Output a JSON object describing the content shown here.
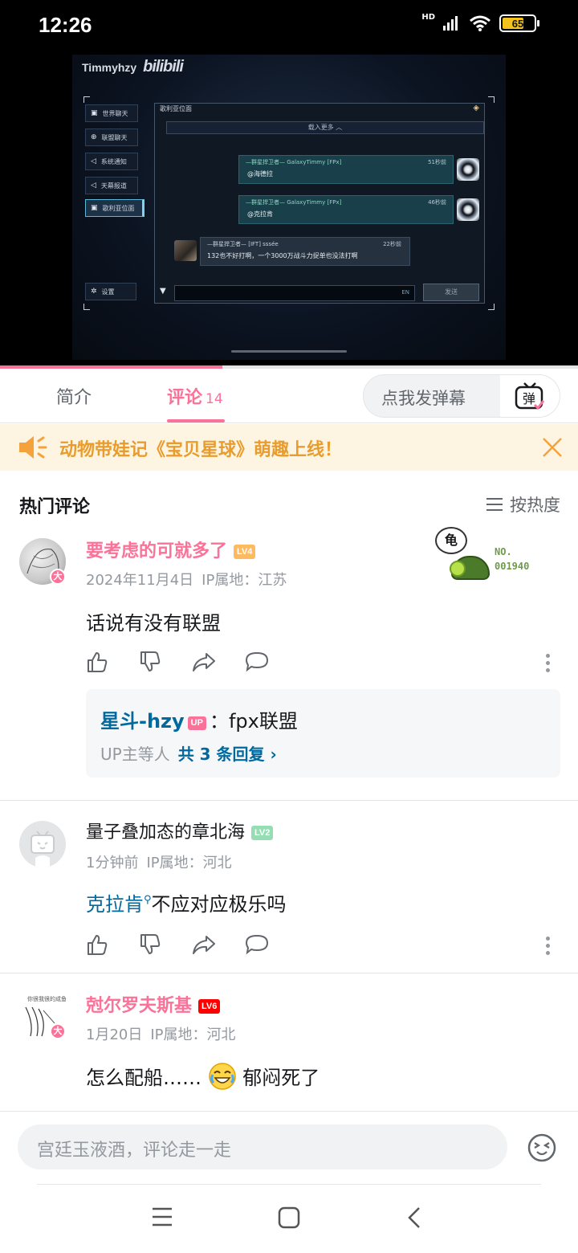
{
  "status_bar": {
    "time": "12:26",
    "network": "HD",
    "battery": "65"
  },
  "video": {
    "watermark_user": "Timmyhzy",
    "watermark_brand": "bilibili",
    "game": {
      "sidebar": [
        {
          "label": "世界聊天",
          "icon": "chat-icon"
        },
        {
          "label": "联盟聊天",
          "icon": "globe-icon"
        },
        {
          "label": "系统通知",
          "icon": "speaker-icon"
        },
        {
          "label": "天幕报道",
          "icon": "speaker-icon"
        },
        {
          "label": "歌利亚位面",
          "icon": "chat-icon",
          "active": true
        }
      ],
      "settings_label": "设置",
      "panel_title": "歌利亚位面",
      "load_more": "载入更多 ︿",
      "messages": [
        {
          "name": "—群星捍卫者— GalaxyTimmy [FPx]",
          "time": "51秒前",
          "text": "@海德拉"
        },
        {
          "name": "—群星捍卫者— GalaxyTimmy [FPx]",
          "time": "46秒前",
          "text": "@克拉肯"
        },
        {
          "name": "—群星捍卫者— [IFT] sssée",
          "time": "22秒前",
          "text": "132也不好打啊，一个3000万战斗力捉单也没法打啊"
        }
      ],
      "input_lang": "EN",
      "send_label": "发送"
    },
    "progress": 0.385
  },
  "tabs": {
    "intro": "简介",
    "comments": "评论",
    "comments_count": "14",
    "danmu_placeholder": "点我发弹幕",
    "danmu_icon_label": "弹"
  },
  "notice": {
    "text": "动物带娃记《宝贝星球》萌趣上线！"
  },
  "hot": {
    "title": "热门评论",
    "sort_label": "按热度"
  },
  "comments": [
    {
      "username": "要考虑的可就多了",
      "level": "LV4",
      "badge": "大",
      "date": "2024年11月4日",
      "ip": "IP属地：江苏",
      "text": "话说有没有联盟",
      "decoration": {
        "bubble": "龟",
        "no_label": "NO.",
        "no_value": "001940"
      },
      "reply": {
        "name": "星斗-hzy",
        "tag": "UP",
        "text": "：fpx联盟",
        "summary": "UP主等人",
        "total": "共 3 条回复",
        "chevron": "›"
      }
    },
    {
      "username": "量子叠加态的章北海",
      "level": "LV2",
      "date": "1分钟前",
      "ip": "IP属地：河北",
      "text_link": "克拉肯",
      "text_rest": "不应对应极乐吗"
    },
    {
      "username": "尅尔罗夫斯基",
      "level": "LV6",
      "badge": "大",
      "avatar_caption": "你很我很的成鱼",
      "date": "1月20日",
      "ip": "IP属地：河北",
      "text_before": "怎么配船……",
      "text_after": "郁闷死了"
    }
  ],
  "composer": {
    "placeholder": "宫廷玉液酒，评论走一走"
  },
  "colors": {
    "accent": "#fb7299",
    "link": "#00699d",
    "lv2": "#95ddb2",
    "lv4": "#feba5e",
    "lv6": "#ff0000"
  }
}
